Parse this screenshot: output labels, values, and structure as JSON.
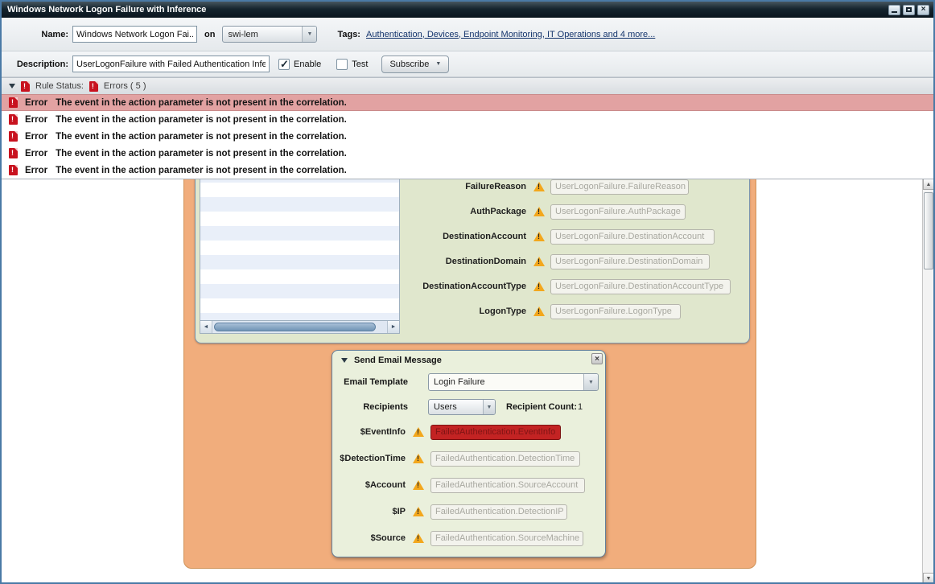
{
  "window": {
    "title": "Windows Network Logon Failure with Inference"
  },
  "icons": {
    "close": "×",
    "dropdown_arrow": "▼",
    "up_arrow": "▲",
    "down_arrow": "▼",
    "left_arrow": "◄",
    "right_arrow": "►"
  },
  "toolbar": {
    "name_label": "Name:",
    "name_value": "Windows Network Logon Fai..",
    "on_label": "on",
    "manager_value": "swi-lem",
    "tags_label": "Tags:",
    "tags_value": "Authentication, Devices, Endpoint Monitoring, IT Operations and 4 more...",
    "description_label": "Description:",
    "description_value": "UserLogonFailure with Failed Authentication Infe",
    "enable_label": "Enable",
    "test_label": "Test",
    "subscribe_label": "Subscribe"
  },
  "rule_status": {
    "label": "Rule Status:",
    "errors_summary": "Errors ( 5 )",
    "errors": [
      {
        "type": "Error",
        "message": "The event in the action parameter is not present in the correlation."
      },
      {
        "type": "Error",
        "message": "The event in the action parameter is not present in the correlation."
      },
      {
        "type": "Error",
        "message": "The event in the action parameter is not present in the correlation."
      },
      {
        "type": "Error",
        "message": "The event in the action parameter is not present in the correlation."
      },
      {
        "type": "Error",
        "message": "The event in the action parameter is not present in the correlation."
      }
    ]
  },
  "correlation_panel": {
    "fields": [
      {
        "label": "FailureReason",
        "value": "UserLogonFailure.FailureReason"
      },
      {
        "label": "AuthPackage",
        "value": "UserLogonFailure.AuthPackage"
      },
      {
        "label": "DestinationAccount",
        "value": "UserLogonFailure.DestinationAccount"
      },
      {
        "label": "DestinationDomain",
        "value": "UserLogonFailure.DestinationDomain"
      },
      {
        "label": "DestinationAccountType",
        "value": "UserLogonFailure.DestinationAccountType"
      },
      {
        "label": "LogonType",
        "value": "UserLogonFailure.LogonType"
      }
    ]
  },
  "email_panel": {
    "title": "Send Email Message",
    "template_label": "Email Template",
    "template_value": "Login Failure",
    "recipients_label": "Recipients",
    "recipients_value": "Users",
    "recipient_count_label": "Recipient Count:",
    "recipient_count_value": "1",
    "fields": [
      {
        "label": "$EventInfo",
        "value": "FailedAuthentication.EventInfo"
      },
      {
        "label": "$DetectionTime",
        "value": "FailedAuthentication.DetectionTime"
      },
      {
        "label": "$Account",
        "value": "FailedAuthentication.SourceAccount"
      },
      {
        "label": "$IP",
        "value": "FailedAuthentication.DetectionIP"
      },
      {
        "label": "$Source",
        "value": "FailedAuthentication.SourceMachine"
      }
    ]
  },
  "colors": {
    "error_row_highlight": "#e2a2a2",
    "error_icon_red": "#c8121f",
    "canvas_orange": "#f1ad7c",
    "panel_green": "#e0e7cd",
    "email_panel_green": "#eaf0dc",
    "warning_yellow": "#f3a71c",
    "invalid_field_red": "#c32323",
    "titlebar_dark": "#15242f",
    "link_blue": "#15356d"
  }
}
